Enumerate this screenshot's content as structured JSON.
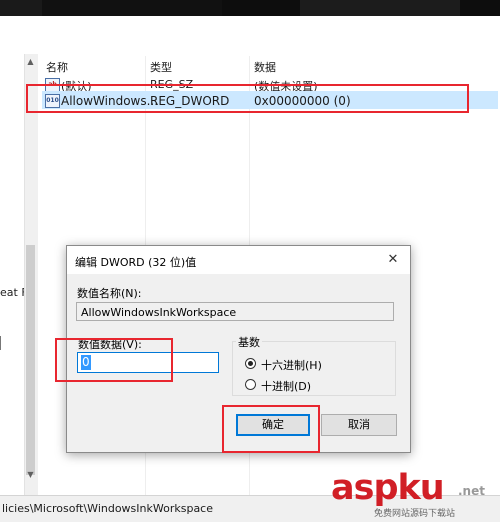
{
  "columns": {
    "name": "名称",
    "type": "类型",
    "data": "数据"
  },
  "values": [
    {
      "name": "(默认)",
      "type": "REG_SZ",
      "data": "(数值未设置)",
      "icon": "string-value-icon"
    },
    {
      "name": "AllowWindows...",
      "type": "REG_DWORD",
      "data": "0x00000000 (0)",
      "icon": "binary-value-icon"
    }
  ],
  "tree": {
    "fragment": "eat F"
  },
  "status_bar": {
    "path": "licies\\Microsoft\\WindowsInkWorkspace"
  },
  "dialog": {
    "title": "编辑 DWORD (32 位)值",
    "value_name_label": "数值名称(N):",
    "value_name": "AllowWindowsInkWorkspace",
    "value_data_label": "数值数据(V):",
    "value_data": "0",
    "base_label": "基数",
    "radio_hex": "十六进制(H)",
    "radio_dec": "十进制(D)",
    "base_selected": "hex",
    "ok": "确定",
    "cancel": "取消",
    "close": "✕"
  },
  "watermark": {
    "brand": "aspku",
    "net": ".net",
    "sub": "免费网站源码下载站"
  },
  "colors": {
    "highlight": "#e8262f",
    "selection": "#cce8ff",
    "accent": "#0078d7"
  }
}
